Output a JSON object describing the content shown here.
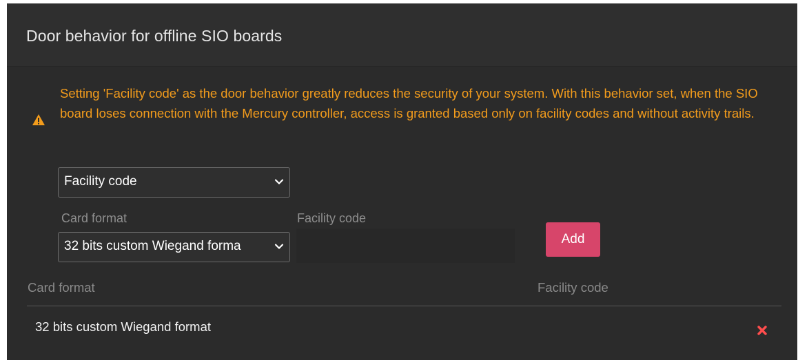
{
  "dialog": {
    "title": "Door behavior for offline SIO boards"
  },
  "warning": {
    "icon": "warning-icon",
    "color": "#f39c1c",
    "text": "Setting 'Facility code' as the door behavior greatly reduces the security of your system. With this behavior set, when the SIO board loses connection with the Mercury controller, access is granted based only on facility codes and without activity trails."
  },
  "behavior": {
    "selected": "Facility code"
  },
  "form": {
    "card_format_label": "Card format",
    "card_format_selected": "32 bits custom Wiegand forma",
    "facility_code_label": "Facility code",
    "facility_code_value": "",
    "add_label": "Add",
    "add_color": "#d7456a"
  },
  "table": {
    "headers": {
      "card_format": "Card format",
      "facility_code": "Facility code"
    },
    "rows": [
      {
        "card_format": "32 bits custom Wiegand format",
        "facility_code": "",
        "delete_icon": "close-icon",
        "delete_color": "#ff4d4d"
      }
    ]
  }
}
